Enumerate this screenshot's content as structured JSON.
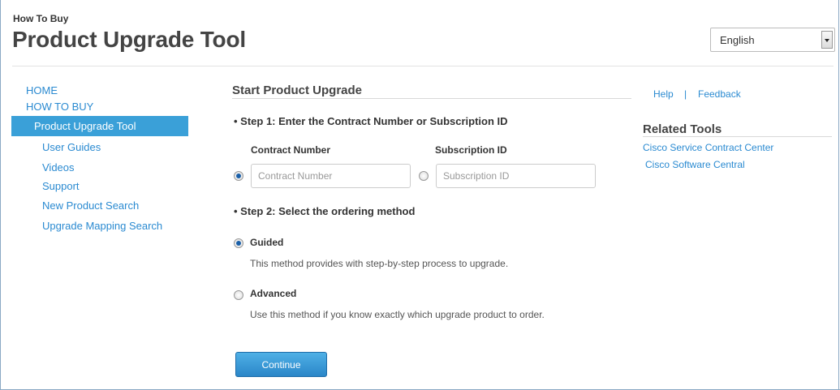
{
  "header": {
    "eyebrow": "How To Buy",
    "title": "Product Upgrade Tool",
    "language": "English"
  },
  "sidebar": {
    "items": [
      {
        "label": "HOME"
      },
      {
        "label": "HOW TO BUY"
      },
      {
        "label": "Product Upgrade Tool",
        "active": true
      },
      {
        "label": "User Guides"
      },
      {
        "label": "Videos"
      },
      {
        "label": "Support"
      },
      {
        "label": "New Product Search"
      },
      {
        "label": "Upgrade Mapping Search"
      }
    ]
  },
  "main": {
    "section_title": "Start Product Upgrade",
    "step1": {
      "heading": "• Step 1: Enter the Contract Number or Subscription ID",
      "contract_label": "Contract Number",
      "contract_placeholder": "Contract Number",
      "contract_value": "",
      "contract_selected": true,
      "subscription_label": "Subscription ID",
      "subscription_placeholder": "Subscription ID",
      "subscription_value": "",
      "subscription_selected": false
    },
    "step2": {
      "heading": "• Step 2: Select the ordering method",
      "guided_label": "Guided",
      "guided_desc": "This method provides with step-by-step process to upgrade.",
      "guided_selected": true,
      "advanced_label": "Advanced",
      "advanced_desc": "Use this method if you know exactly which upgrade product to order.",
      "advanced_selected": false
    },
    "continue_label": "Continue"
  },
  "aside": {
    "help": "Help",
    "separator": "|",
    "feedback": "Feedback",
    "related_title": "Related Tools",
    "related_links": [
      {
        "label": "Cisco Service Contract Center"
      },
      {
        "label": "Cisco Software Central"
      }
    ]
  },
  "colors": {
    "link": "#2a8ad1",
    "nav_active_bg": "#3aa0d8",
    "button_bg": "#2a86c8"
  }
}
